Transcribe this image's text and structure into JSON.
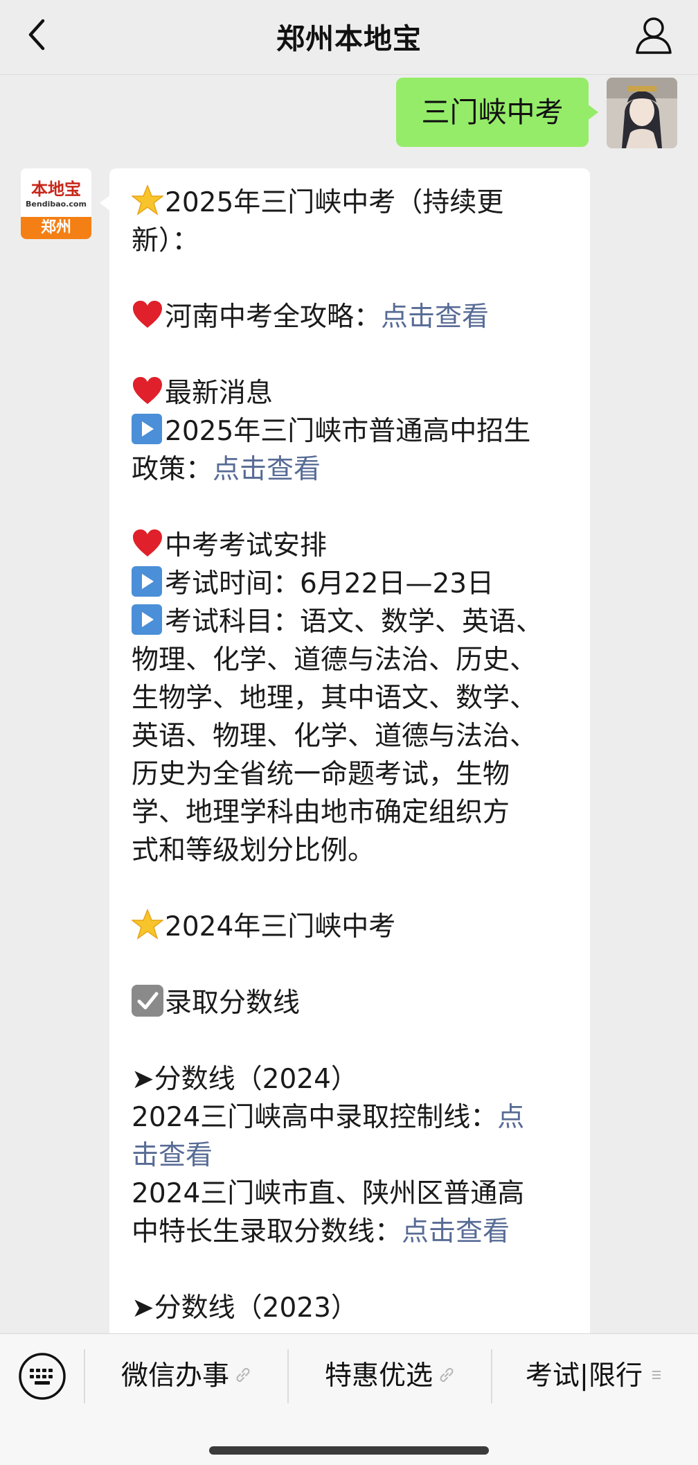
{
  "nav": {
    "title": "郑州本地宝"
  },
  "sent_message": {
    "text": "三门峡中考"
  },
  "bot_avatar": {
    "logo_cn": "本地宝",
    "logo_en": "Bendibao.com",
    "city": "郑州"
  },
  "reply": {
    "l1": "2025年三门峡中考（持续更",
    "l2": "新）：",
    "l3_text": "河南中考全攻略：",
    "l3_link": "点击查看",
    "l4": "最新消息",
    "l5": "2025年三门峡市普通高中招生",
    "l6_text": "政策：",
    "l6_link": "点击查看",
    "l7": "中考考试安排",
    "l8": "考试时间：6月22日—23日",
    "l9": "考试科目：语文、数学、英语、",
    "l10": "物理、化学、道德与法治、历史、",
    "l11": "生物学、地理，其中语文、数学、",
    "l12": "英语、物理、化学、道德与法治、",
    "l13": "历史为全省统一命题考试，生物",
    "l14": "学、地理学科由地市确定组织方",
    "l15": "式和等级划分比例。",
    "l16": "2024年三门峡中考",
    "l17": "录取分数线",
    "l18": "➤分数线（2024）",
    "l19_text": "2024三门峡高中录取控制线：",
    "l19_link": "点",
    "l20_link": "击查看",
    "l21": "2024三门峡市直、陕州区普通高",
    "l22_text": "中特长生录取分数线：",
    "l22_link": "点击查看",
    "l23": "➤分数线（2023）"
  },
  "bottom_menu": {
    "item1": "微信办事",
    "item2": "特惠优选",
    "item3": "考试|限行"
  },
  "colors": {
    "link": "#576b95",
    "sent_bubble": "#95ec69",
    "background": "#ededed"
  },
  "icons": [
    "back-chevron-icon",
    "profile-icon",
    "star-emoji",
    "heart-emoji",
    "play-button-emoji",
    "checkbox-emoji",
    "keyboard-icon",
    "link-icon",
    "menu-lines-icon"
  ]
}
